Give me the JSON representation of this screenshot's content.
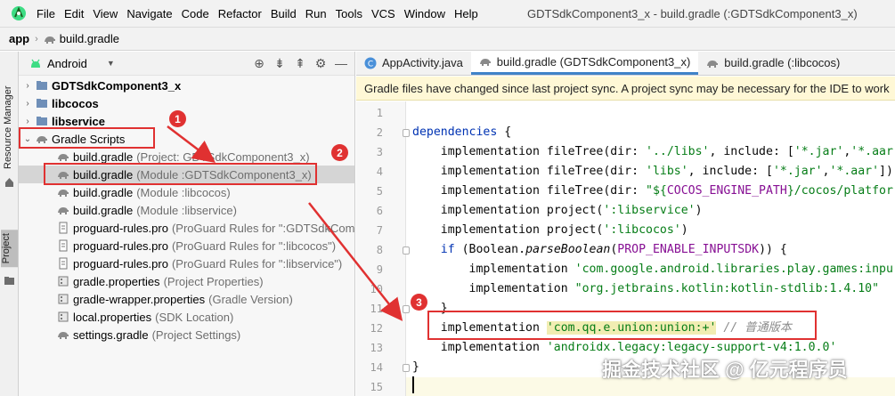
{
  "menubar": {
    "items": [
      "File",
      "Edit",
      "View",
      "Navigate",
      "Code",
      "Refactor",
      "Build",
      "Run",
      "Tools",
      "VCS",
      "Window",
      "Help"
    ],
    "window_title": "GDTSdkComponent3_x - build.gradle (:GDTSdkComponent3_x)"
  },
  "breadcrumb": {
    "root": "app",
    "file": "build.gradle"
  },
  "side_strip": {
    "resource_manager": "Resource Manager",
    "project": "Project"
  },
  "project_panel": {
    "view_selector": "Android",
    "tree": {
      "modules": [
        "GDTSdkComponent3_x",
        "libcocos",
        "libservice"
      ],
      "gradle_scripts": "Gradle Scripts",
      "files": [
        {
          "name": "build.gradle",
          "hint": "(Project: GDTSdkComponent3_x)"
        },
        {
          "name": "build.gradle",
          "hint": "(Module :GDTSdkComponent3_x)"
        },
        {
          "name": "build.gradle",
          "hint": "(Module :libcocos)"
        },
        {
          "name": "build.gradle",
          "hint": "(Module :libservice)"
        },
        {
          "name": "proguard-rules.pro",
          "hint": "(ProGuard Rules for \":GDTSdkCom"
        },
        {
          "name": "proguard-rules.pro",
          "hint": "(ProGuard Rules for \":libcocos\")"
        },
        {
          "name": "proguard-rules.pro",
          "hint": "(ProGuard Rules for \":libservice\")"
        },
        {
          "name": "gradle.properties",
          "hint": "(Project Properties)"
        },
        {
          "name": "gradle-wrapper.properties",
          "hint": "(Gradle Version)"
        },
        {
          "name": "local.properties",
          "hint": "(SDK Location)"
        },
        {
          "name": "settings.gradle",
          "hint": "(Project Settings)"
        }
      ]
    }
  },
  "editor": {
    "tabs": [
      "AppActivity.java",
      "build.gradle (GDTSdkComponent3_x)",
      "build.gradle (:libcocos)"
    ],
    "sync_banner": "Gradle files have changed since last project sync. A project sync may be necessary for the IDE to work",
    "line_numbers": [
      "1",
      "2",
      "3",
      "4",
      "5",
      "6",
      "7",
      "8",
      "9",
      "10",
      "11",
      "12",
      "13",
      "14",
      "15"
    ],
    "code": {
      "l2_kw": "dependencies",
      "l2_rest": " {",
      "l3_a": "    implementation fileTree(dir: ",
      "l3_s1": "'../libs'",
      "l3_b": ", include: [",
      "l3_s2": "'*.jar'",
      "l3_c": ",",
      "l3_s3": "'*.aar",
      "l4_a": "    implementation fileTree(dir: ",
      "l4_s1": "'libs'",
      "l4_b": ", include: [",
      "l4_s2": "'*.jar'",
      "l4_c": ",",
      "l4_s3": "'*.aar'",
      "l4_d": "])",
      "l5_a": "    implementation fileTree(dir: ",
      "l5_s1": "\"${",
      "l5_c1": "COCOS_ENGINE_PATH",
      "l5_s2": "}/cocos/platfor",
      "l6_a": "    implementation project(",
      "l6_s": "':libservice'",
      "l6_b": ")",
      "l7_a": "    implementation project(",
      "l7_s": "':libcocos'",
      "l7_b": ")",
      "l8_a": "    ",
      "l8_kw": "if",
      "l8_b": " (Boolean.",
      "l8_it": "parseBoolean",
      "l8_c": "(",
      "l8_cst": "PROP_ENABLE_INPUTSDK",
      "l8_d": ")) {",
      "l9_a": "        implementation ",
      "l9_s": "'com.google.android.libraries.play.games:inpu",
      "l10_a": "        implementation ",
      "l10_s": "\"org.jetbrains.kotlin:kotlin-stdlib:1.4.10\"",
      "l11": "    }",
      "l12_a": "    implementation ",
      "l12_s": "'com.qq.e.union:union:+'",
      "l12_cmt": " // 普通版本",
      "l13_a": "    implementation ",
      "l13_s": "'androidx.legacy:legacy-support-v4:1.0.0'",
      "l14": "}"
    }
  },
  "annotations": {
    "badge1": "1",
    "badge2": "2",
    "badge3": "3"
  },
  "watermark": "掘金技术社区 @ 亿元程序员",
  "colors": {
    "annotation_red": "#e03131",
    "active_tab_underline": "#4083c9",
    "banner_bg": "#fff8d6",
    "keyword": "#0033b3",
    "string": "#067d17"
  }
}
